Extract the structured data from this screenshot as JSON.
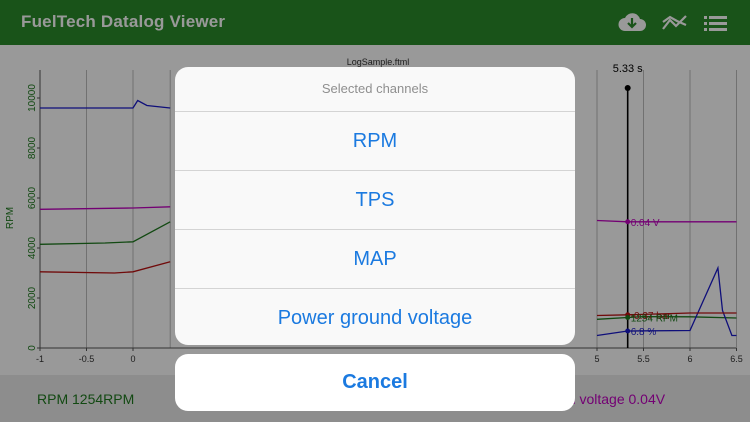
{
  "app": {
    "title": "FuelTech Datalog Viewer"
  },
  "header_icons": [
    "cloud-download-icon",
    "chart-line-icon",
    "list-icon"
  ],
  "chart": {
    "file_name": "LogSample.ftml",
    "cursor_time_label": "5.33 s",
    "y_axis_label": "RPM",
    "y_ticks": [
      "0",
      "2000",
      "4000",
      "6000",
      "8000",
      "10000"
    ],
    "x_ticks": [
      "-1",
      "-0.5",
      "0",
      "5",
      "5.5",
      "6",
      "6.5"
    ],
    "cursor_labels": {
      "voltage": "0.04 V",
      "map": "-0.37 bar",
      "rpm": "1254 RPM",
      "tps": "6.8 %"
    }
  },
  "chart_data": {
    "type": "line",
    "title": "LogSample.ftml",
    "ylabel": "RPM",
    "ylim": [
      0,
      10000
    ],
    "xlim": [
      -1,
      6.5
    ],
    "cursor_x": 5.33,
    "series": [
      {
        "name": "RPM",
        "color": "#1f7a1f",
        "x": [
          -1,
          -0.3,
          0,
          0.4,
          5,
          5.5,
          6,
          6.5
        ],
        "y": [
          4150,
          4200,
          4250,
          5050,
          1150,
          1254,
          1250,
          1200
        ]
      },
      {
        "name": "TPS",
        "color": "#1a1acc",
        "x": [
          -1,
          0,
          0.05,
          0.15,
          0.4,
          5,
          5.33,
          6,
          6.3,
          6.35,
          6.45,
          6.5
        ],
        "y": [
          9600,
          9600,
          9900,
          9700,
          9600,
          500,
          680,
          700,
          3200,
          1500,
          500,
          500
        ]
      },
      {
        "name": "MAP",
        "color": "#bb1111",
        "x": [
          -1,
          -0.2,
          0,
          0.4,
          5,
          5.33,
          6,
          6.5
        ],
        "y": [
          3050,
          3000,
          3050,
          3450,
          1300,
          1330,
          1400,
          1400
        ]
      },
      {
        "name": "Power ground voltage",
        "color": "#c000c0",
        "x": [
          -1,
          0,
          0.4,
          5,
          5.33,
          6,
          6.5
        ],
        "y": [
          5550,
          5600,
          5650,
          5100,
          5050,
          5050,
          5050
        ]
      }
    ]
  },
  "status_bar": {
    "left_text": "RPM 1254RPM",
    "right_text": "nd voltage 0.04V"
  },
  "action_sheet": {
    "title": "Selected channels",
    "items": [
      "RPM",
      "TPS",
      "MAP",
      "Power ground voltage"
    ],
    "cancel_label": "Cancel"
  }
}
